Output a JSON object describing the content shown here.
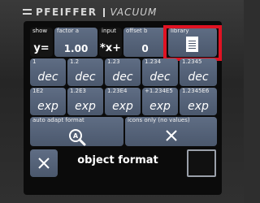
{
  "brand": {
    "name": "PFEIFFER",
    "product": "VACUUM"
  },
  "header_row": {
    "show": {
      "label": "show",
      "value": "y="
    },
    "factor": {
      "label": "factor a",
      "value": "1.00"
    },
    "input": {
      "label": "input",
      "value": "*x+"
    },
    "offset": {
      "label": "offset b",
      "value": "0"
    },
    "library": {
      "label": "library"
    }
  },
  "dec_row": [
    {
      "label": "1",
      "value": "dec"
    },
    {
      "label": "1.2",
      "value": "dec"
    },
    {
      "label": "1.23",
      "value": "dec"
    },
    {
      "label": "1.234",
      "value": "dec"
    },
    {
      "label": "1.2345",
      "value": "dec"
    }
  ],
  "exp_row": [
    {
      "label": "1E2",
      "value": "exp"
    },
    {
      "label": "1.2E3",
      "value": "exp"
    },
    {
      "label": "1.23E4",
      "value": "exp"
    },
    {
      "label": "+1.234E5",
      "value": "exp"
    },
    {
      "label": "1.2345E6",
      "value": "exp"
    }
  ],
  "options": {
    "auto_adapt": "auto adapt format",
    "icons_only": "icons only (no values)"
  },
  "footer": {
    "title": "object format"
  },
  "colors": {
    "button": "#56637a",
    "highlight": "#e01323",
    "screen": "#0b0b0b"
  },
  "icons": {
    "library": "document-icon",
    "auto_adapt": "search-icon",
    "icons_only": "close-icon",
    "cancel": "close-icon"
  }
}
